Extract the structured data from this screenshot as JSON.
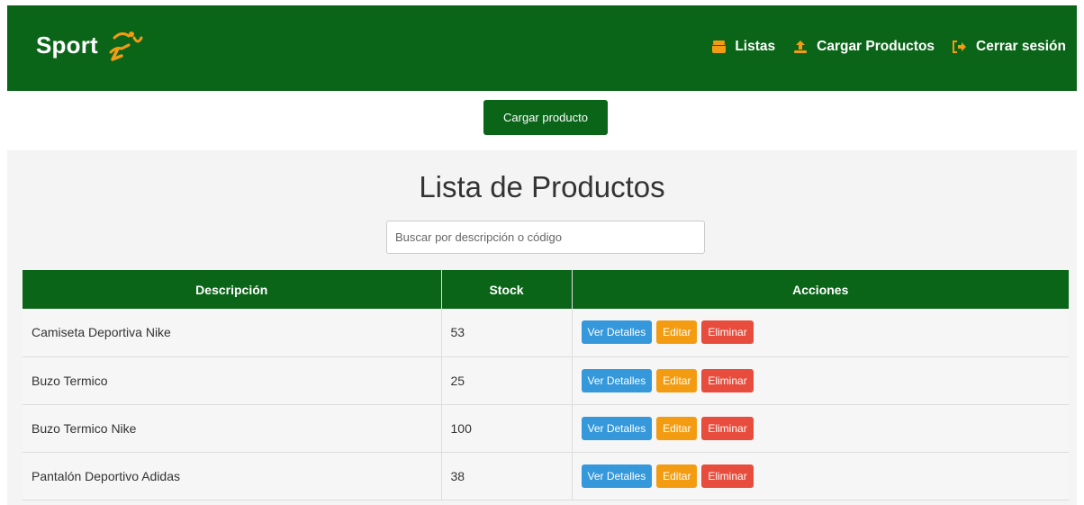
{
  "navbar": {
    "brand": "Sport",
    "links": [
      {
        "label": "Listas",
        "icon": "box-icon"
      },
      {
        "label": "Cargar Productos",
        "icon": "upload-icon"
      },
      {
        "label": "Cerrar sesión",
        "icon": "sign-out-icon"
      }
    ]
  },
  "toolbar": {
    "cargar_label": "Cargar producto"
  },
  "main": {
    "title": "Lista de Productos",
    "search_placeholder": "Buscar por descripción o código"
  },
  "table": {
    "headers": [
      "Descripción",
      "Stock",
      "Acciones"
    ],
    "rows": [
      {
        "descripcion": "Camiseta Deportiva Nike",
        "stock": "53"
      },
      {
        "descripcion": "Buzo Termico",
        "stock": "25"
      },
      {
        "descripcion": "Buzo Termico Nike",
        "stock": "100"
      },
      {
        "descripcion": "Pantalón Deportivo Adidas",
        "stock": "38"
      }
    ],
    "actions": {
      "details": "Ver Detalles",
      "edit": "Editar",
      "delete": "Eliminar"
    }
  },
  "colors": {
    "primary_green": "#0b6519",
    "accent_orange": "#f39c12",
    "details_blue": "#3498db",
    "delete_red": "#e74c3c"
  }
}
